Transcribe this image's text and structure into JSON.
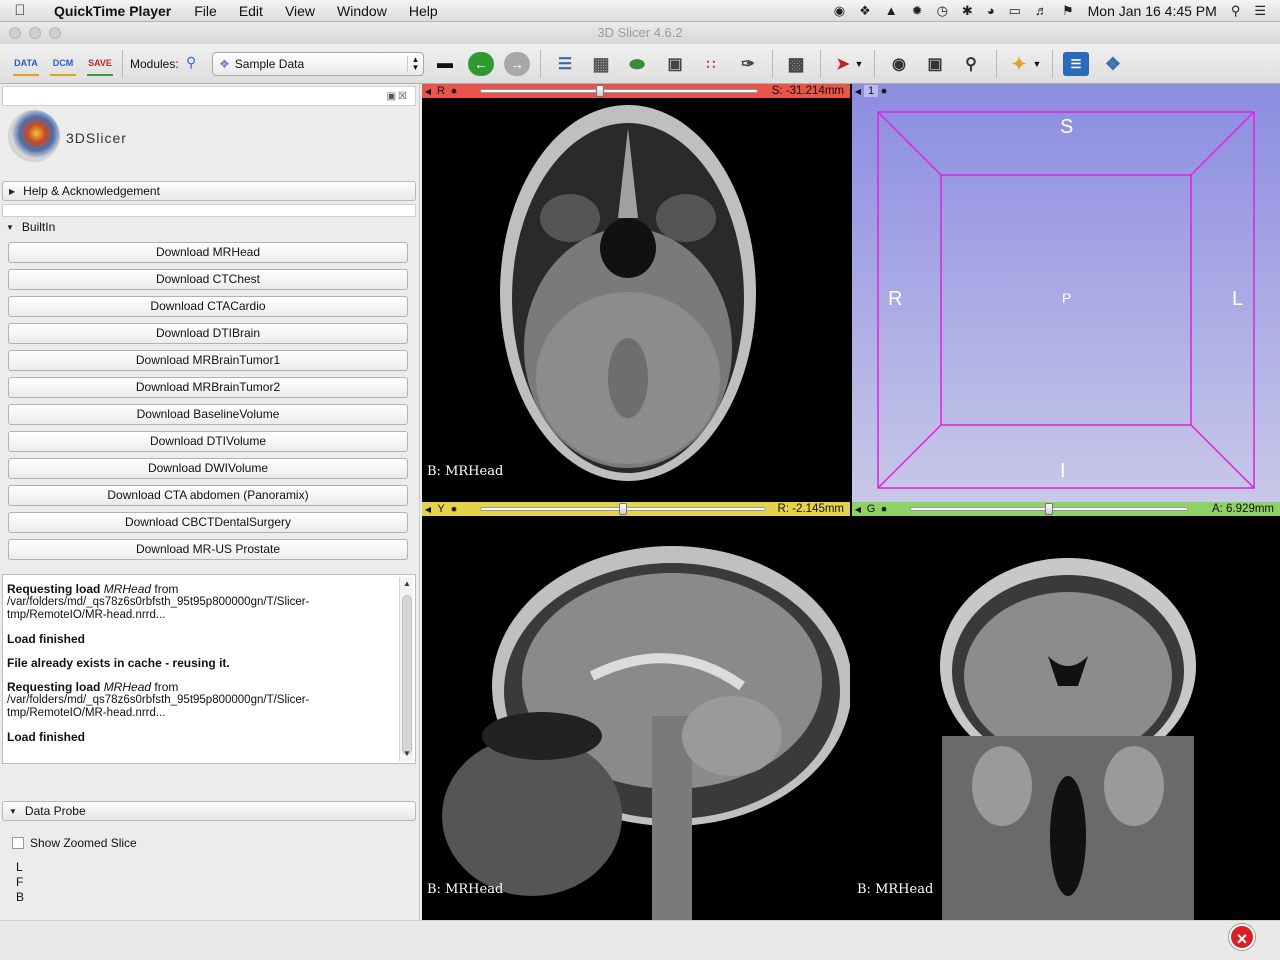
{
  "menubar": {
    "app_name": "QuickTime Player",
    "items": [
      "File",
      "Edit",
      "View",
      "Window",
      "Help"
    ],
    "datetime": "Mon Jan 16  4:45 PM"
  },
  "window": {
    "title": "3D Slicer 4.6.2"
  },
  "toolbar": {
    "data_label": "DATA",
    "dcm_label": "DCM",
    "save_label": "SAVE",
    "modules_label": "Modules:",
    "module_selected": "Sample Data"
  },
  "left_panel": {
    "logo_text": "3DSlicer",
    "help_section": "Help & Acknowledgement",
    "builtin_label": "BuiltIn",
    "downloads": [
      "Download MRHead",
      "Download CTChest",
      "Download CTACardio",
      "Download DTIBrain",
      "Download MRBrainTumor1",
      "Download MRBrainTumor2",
      "Download BaselineVolume",
      "Download DTIVolume",
      "Download DWIVolume",
      "Download CTA abdomen (Panoramix)",
      "Download CBCTDentalSurgery",
      "Download MR-US Prostate"
    ],
    "log": {
      "req1_prefix": "Requesting load",
      "req1_name": "MRHead",
      "req1_suffix": "from",
      "req1_path": "/var/folders/md/_qs78z6s0rbfsth_95t95p800000gn/T/Slicer-tmp/RemoteIO/MR-head.nrrd...",
      "load_finished_1": "Load finished",
      "cache_msg": "File already exists in cache - reusing it.",
      "req2_prefix": "Requesting load",
      "req2_name": "MRHead",
      "req2_suffix": "from",
      "req2_path": "/var/folders/md/_qs78z6s0rbfsth_95t95p800000gn/T/Slicer-tmp/RemoteIO/MR-head.nrrd...",
      "load_finished_2": "Load finished"
    },
    "data_probe": {
      "title": "Data Probe",
      "show_zoomed": "Show Zoomed Slice",
      "lines": [
        "L",
        "F",
        "B"
      ]
    }
  },
  "views": {
    "red": {
      "label": "R",
      "offset": "S: -31.214mm",
      "volume": "B: MRHead",
      "color": "#e8534a",
      "slider_fraction": 0.43
    },
    "threed": {
      "label": "1",
      "color": "#8c8ee0",
      "orient": {
        "top": "S",
        "left": "R",
        "right": "L",
        "center": "P",
        "bottom": "I"
      }
    },
    "yellow": {
      "label": "Y",
      "offset": "R: -2.145mm",
      "volume": "B: MRHead",
      "color": "#e6d24a",
      "slider_fraction": 0.5
    },
    "green": {
      "label": "G",
      "offset": "A: 6.929mm",
      "volume": "B: MRHead",
      "color": "#8ed166",
      "slider_fraction": 0.5
    }
  }
}
